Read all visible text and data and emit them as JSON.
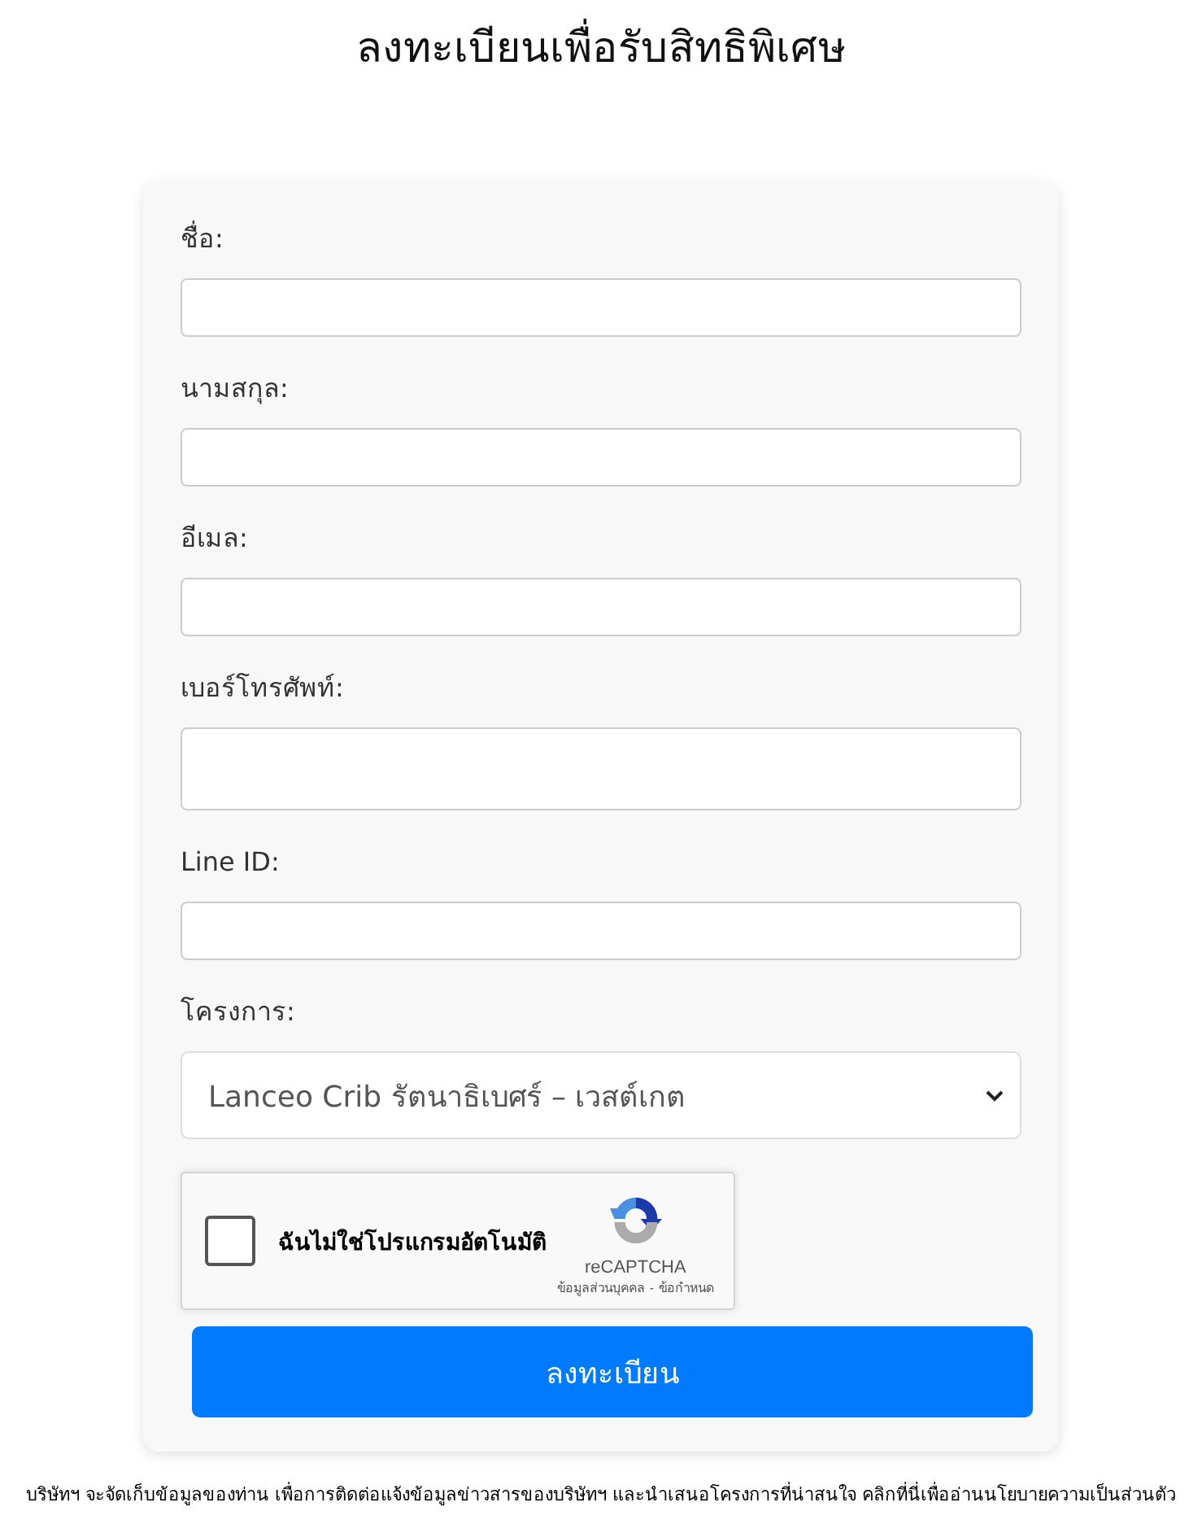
{
  "page": {
    "title": "ลงทะเบียนเพื่อรับสิทธิพิเศษ"
  },
  "form": {
    "fields": [
      {
        "label": "ชื่อ:",
        "kind": "text"
      },
      {
        "label": "นามสกุล:",
        "kind": "text"
      },
      {
        "label": "อีเมล:",
        "kind": "text"
      },
      {
        "label": "เบอร์โทรศัพท์:",
        "kind": "phone"
      },
      {
        "label": "Line ID:",
        "kind": "text"
      },
      {
        "label": "โครงการ:",
        "kind": "select",
        "value": "Lanceo Crib รัตนาธิเบศร์ – เวสต์เกต"
      }
    ],
    "captcha": {
      "checked": false,
      "label": "ฉันไม่ใช่โปรแกรมอัตโนมัติ",
      "brand": "reCAPTCHA",
      "links": [
        "ข้อมูลส่วนบุคคล",
        "ข้อกำหนด"
      ],
      "separator": "-"
    },
    "submit": "ลงทะเบียน"
  },
  "footer": {
    "notice": "บริษัทฯ จะจัดเก็บข้อมูลของท่าน เพื่อการติดต่อแจ้งข้อมูลข่าวสารของบริษัทฯ และนำเสนอโครงการที่น่าสนใจ คลิกที่นี่เพื่ออ่านนโยบายความเป็นส่วนตัว"
  }
}
